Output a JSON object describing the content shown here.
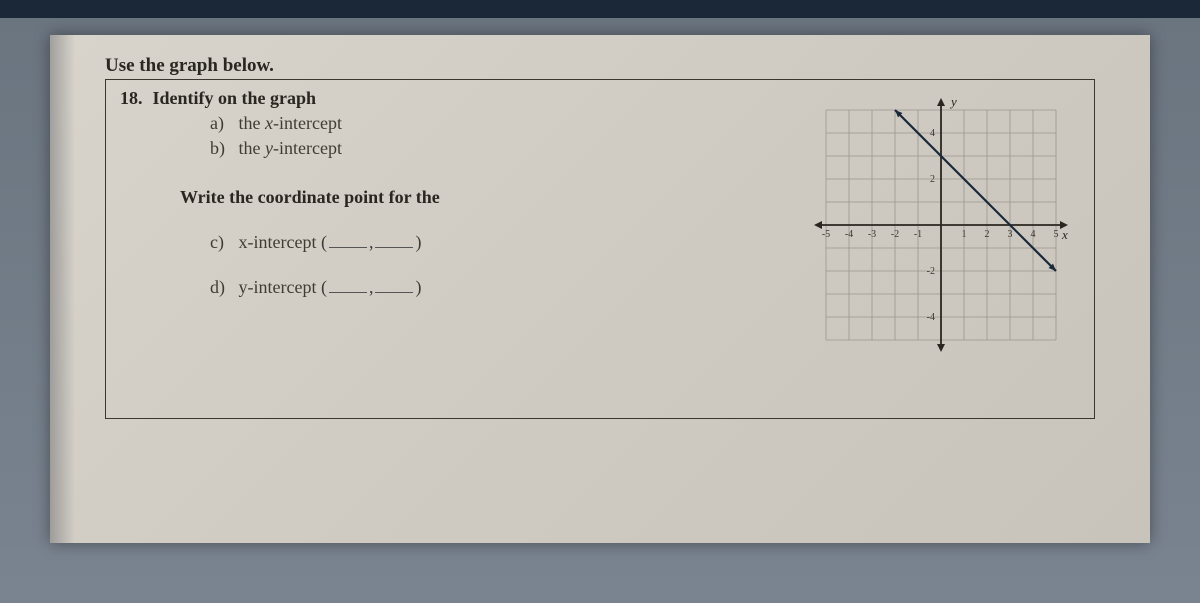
{
  "title": "Use the graph below.",
  "problem": {
    "number": "18.",
    "heading": "Identify on the graph",
    "item_a": {
      "letter": "a)",
      "text_pre": "the ",
      "var": "x",
      "text_post": "-intercept"
    },
    "item_b": {
      "letter": "b)",
      "text_pre": "the ",
      "var": "y",
      "text_post": "-intercept"
    },
    "write_heading": "Write the coordinate point for the",
    "item_c": {
      "letter": "c)",
      "label": "x-intercept",
      "open": "(",
      "sep": ",",
      "close": ")"
    },
    "item_d": {
      "letter": "d)",
      "label": "y-intercept",
      "open": "(",
      "sep": ",",
      "close": ")"
    }
  },
  "chart_data": {
    "type": "line",
    "title": "",
    "xlabel": "x",
    "ylabel": "y",
    "xlim": [
      -5,
      5
    ],
    "ylim": [
      -5,
      5
    ],
    "x_ticks": [
      -5,
      -4,
      -3,
      -2,
      -1,
      1,
      2,
      3,
      4,
      5
    ],
    "y_ticks": [
      -4,
      -2,
      2,
      4
    ],
    "series": [
      {
        "name": "line",
        "x": [
          -2,
          5
        ],
        "y": [
          5,
          -2
        ]
      }
    ],
    "grid": true,
    "x_intercept": [
      3,
      0
    ],
    "y_intercept": [
      0,
      3
    ]
  }
}
